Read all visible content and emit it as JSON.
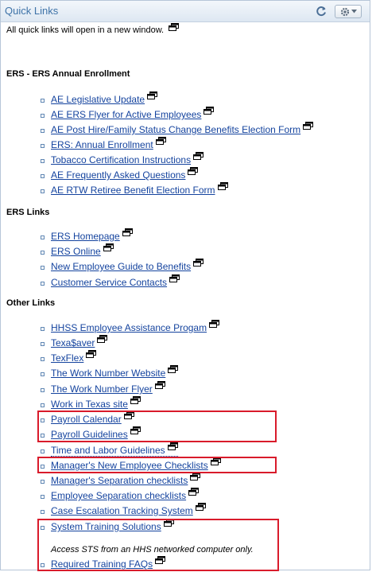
{
  "header": {
    "title": "Quick Links",
    "refresh_icon": "refresh-icon",
    "options_icon": "gear-icon"
  },
  "intro_text": "All quick links will open in a new window.",
  "sections": [
    {
      "heading": "ERS - ERS Annual Enrollment",
      "links": [
        "AE Legislative Update",
        "AE ERS Flyer for Active Employees",
        "AE Post Hire/Family Status Change Benefits Election Form",
        "ERS: Annual Enrollment",
        "Tobacco Certification Instructions",
        "AE Frequently Asked Questions",
        "AE RTW Retiree Benefit Election Form"
      ]
    },
    {
      "heading": "ERS Links",
      "links": [
        "ERS Homepage",
        "ERS Online",
        "New Employee Guide to Benefits",
        "Customer Service Contacts"
      ]
    },
    {
      "heading": "Other Links",
      "links": [
        "HHSS Employee Assistance Progam",
        "Texa$aver",
        "TexFlex",
        "The Work Number Website",
        "The Work Number Flyer",
        "Work in Texas site",
        "Payroll Calendar",
        "Payroll Guidelines",
        "Time and Labor Guidelines",
        "Manager's New Employee Checklists",
        "Manager's Separation checklists",
        "Employee Separation checklists",
        "Case Escalation Tracking System",
        "System Training Solutions",
        "Required Training FAQs"
      ]
    }
  ],
  "sts_note": "Access STS from an HHS networked computer only.",
  "colors": {
    "link": "#14439e",
    "title": "#3e73a8",
    "highlight": "#d91b2b"
  }
}
